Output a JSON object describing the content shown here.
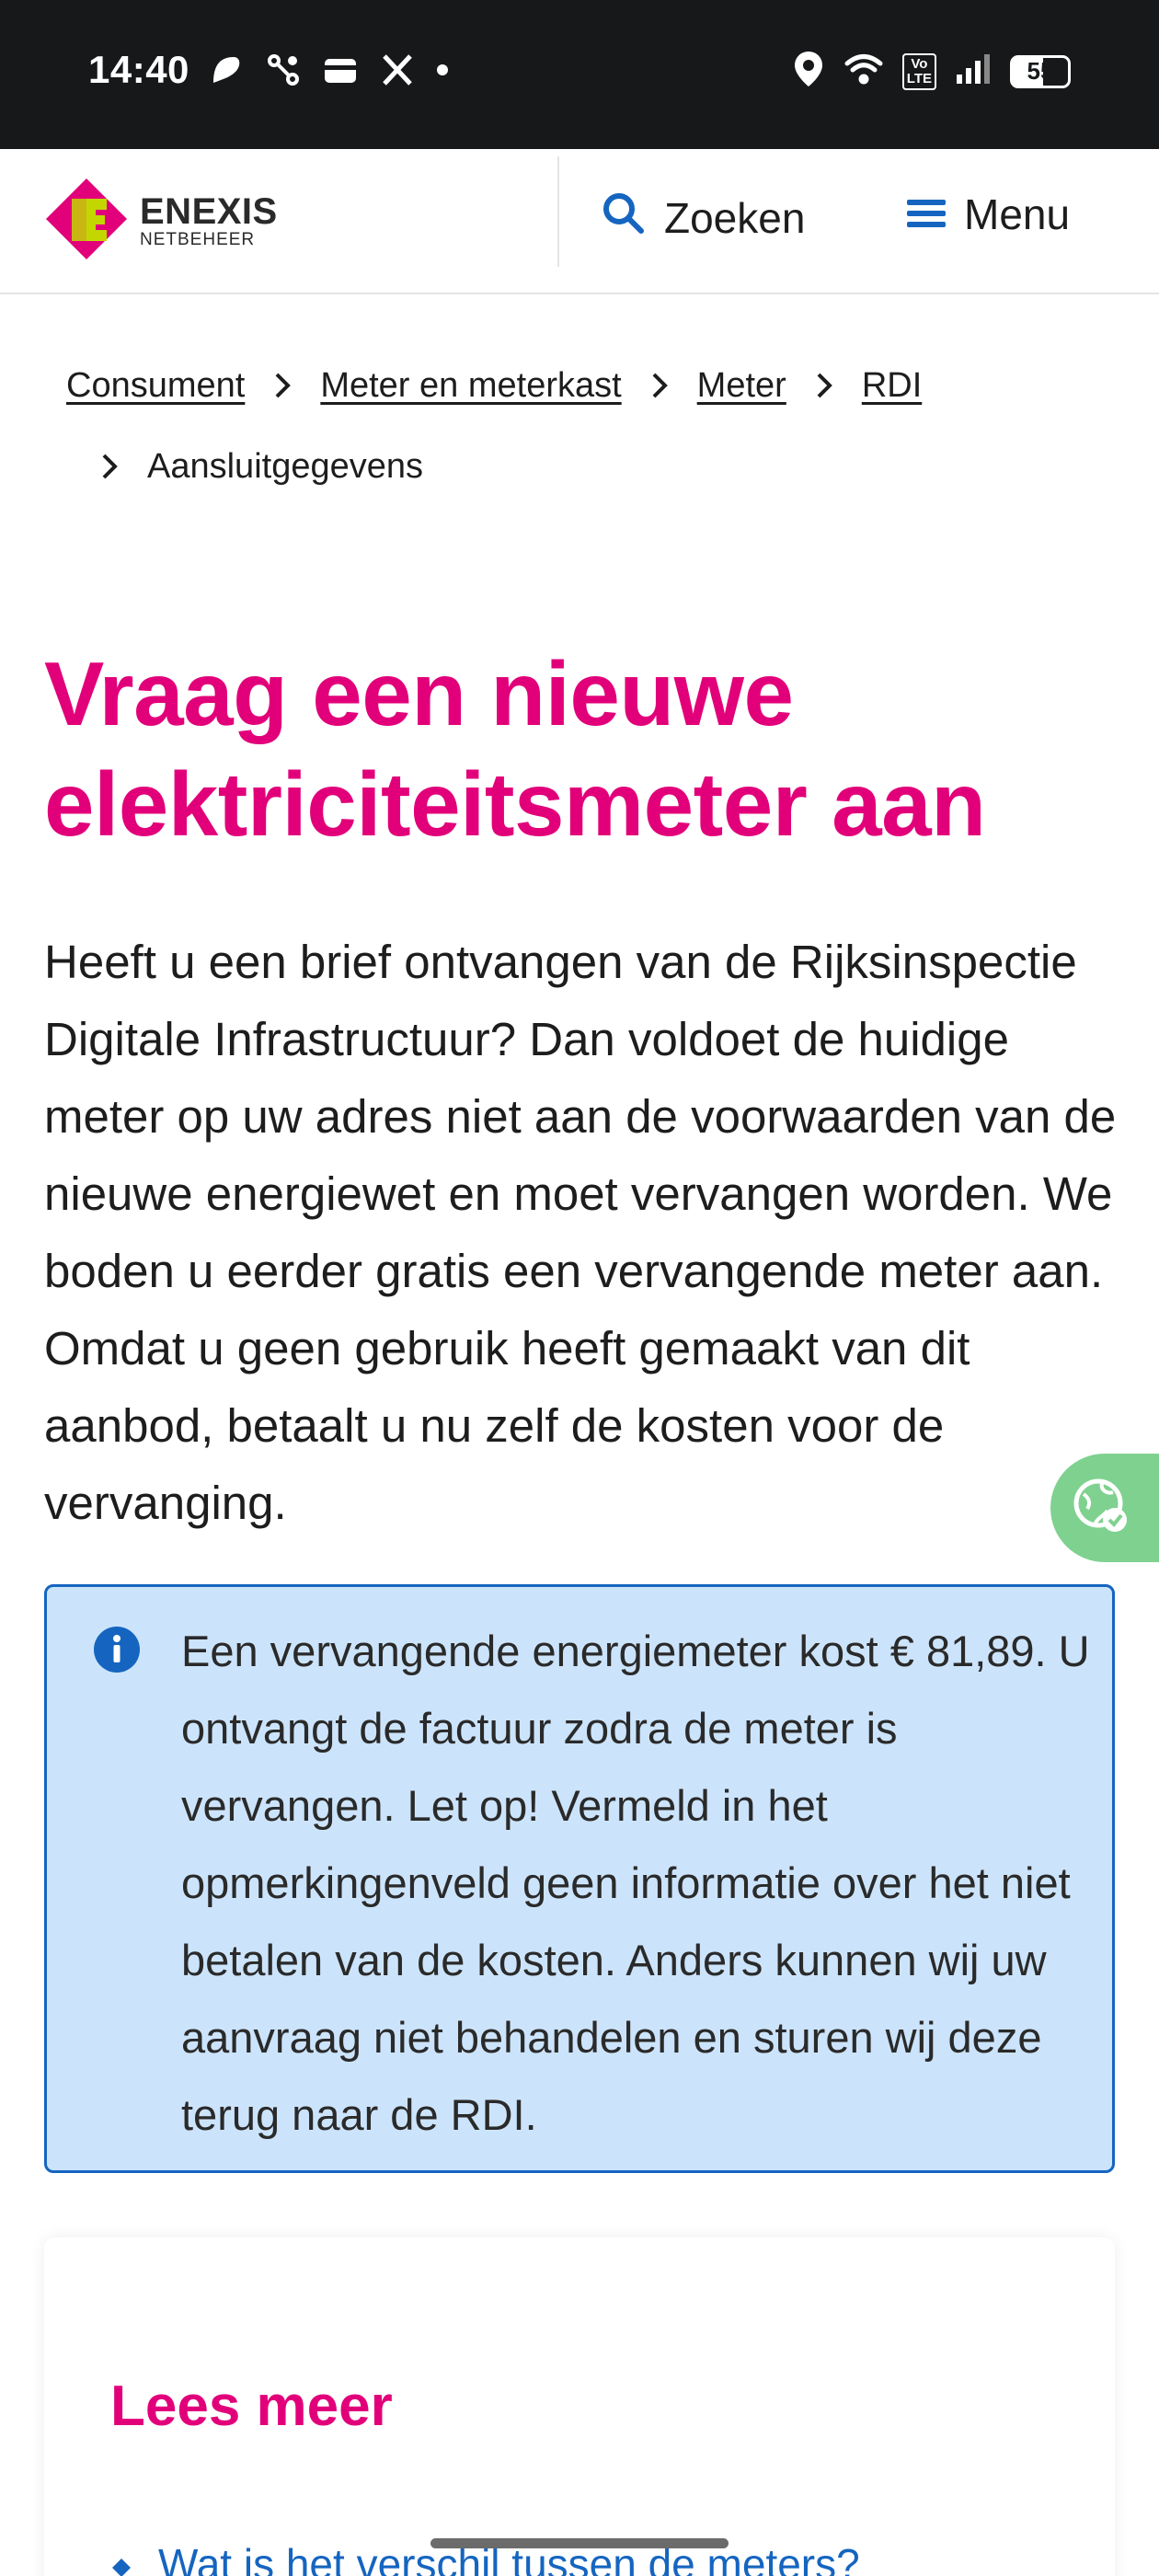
{
  "status_bar": {
    "time": "14:40",
    "left_icons": [
      "notification-icon",
      "link-icon",
      "wallet-icon",
      "x-icon",
      "dot-icon"
    ],
    "right_icons": [
      "location-icon",
      "wifi-icon",
      "volte-icon",
      "signal-icon",
      "battery-icon"
    ],
    "volte_line1": "Vo",
    "volte_line2": "LTE",
    "battery": "55"
  },
  "header": {
    "logo_name": "ENEXIS",
    "logo_sub": "NETBEHEER",
    "search_label": "Zoeken",
    "menu_label": "Menu"
  },
  "breadcrumb": {
    "items": [
      "Consument",
      "Meter en meterkast",
      "Meter",
      "RDI"
    ],
    "current": "Aansluitgegevens"
  },
  "page": {
    "title": "Vraag een nieuwe elektriciteitsmeter aan",
    "intro": "Heeft u een brief ontvangen van de Rijksinspectie Digitale Infrastructuur? Dan voldoet de huidige meter op uw adres niet aan de voorwaarden van de nieuwe energiewet en moet vervangen worden. We boden u eerder gratis een vervangende meter aan. Omdat u geen gebruik heeft gemaakt van dit aanbod, betaalt u nu zelf de kosten voor de vervanging."
  },
  "info_box": {
    "text": "Een vervangende energiemeter kost € 81,89. U ontvangt de factuur zodra de meter is vervangen. Let op! Vermeld in het opmerkingenveld geen informatie over het niet betalen van de kosten. Anders kunnen wij uw aanvraag niet behandelen en sturen wij deze terug naar de RDI."
  },
  "read_more": {
    "title": "Lees meer",
    "links": [
      "Wat is het verschil tussen de meters?"
    ]
  },
  "colors": {
    "brand_pink": "#e2007a",
    "brand_lime": "#c3d600",
    "link_blue": "#1565c0",
    "info_bg": "#cce4fb",
    "feedback_green": "#7fd18f"
  }
}
